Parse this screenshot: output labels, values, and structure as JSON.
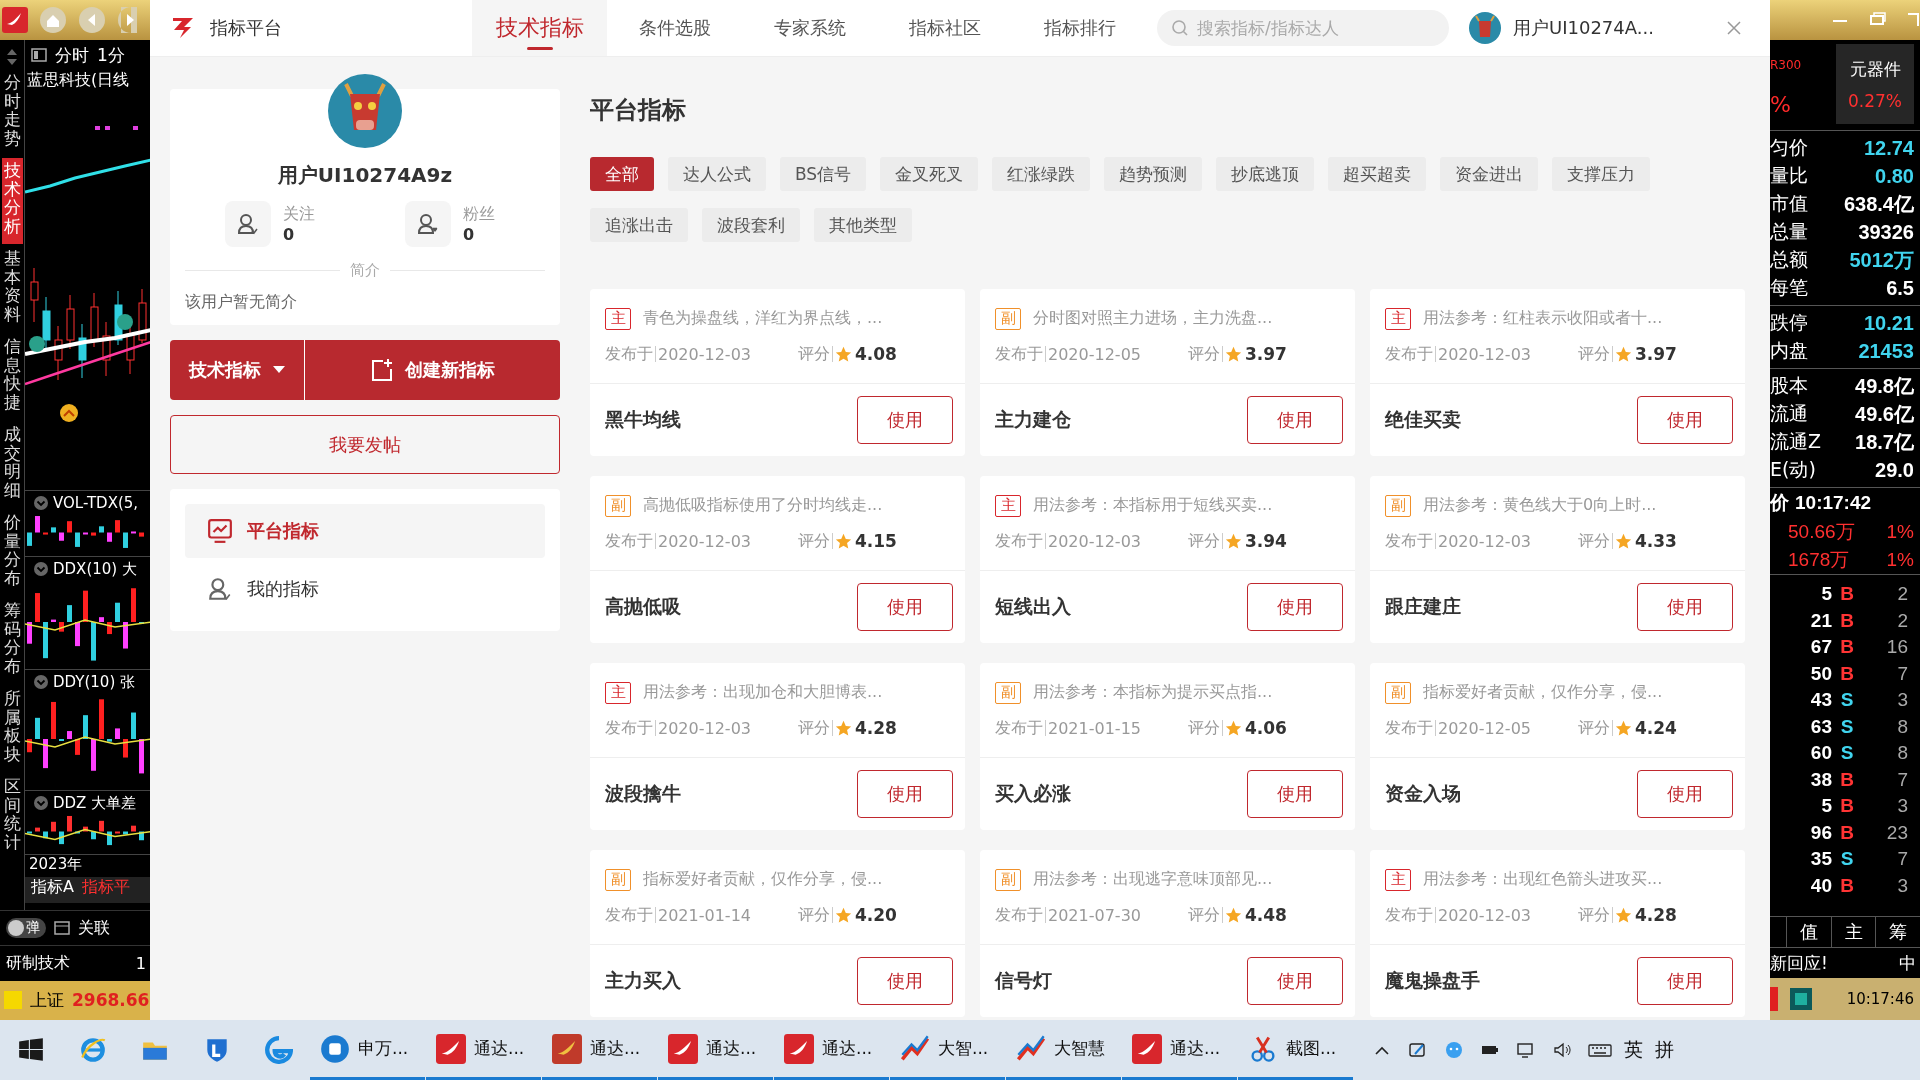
{
  "stock_app": {
    "left": {
      "vertical_tabs": [
        {
          "label": "分时走势",
          "selected": false
        },
        {
          "label": "技术分析",
          "selected": true
        },
        {
          "label": "基本资料",
          "selected": false
        },
        {
          "label": "信息快捷",
          "selected": false
        },
        {
          "label": "成交明细",
          "selected": false
        },
        {
          "label": "价量分布",
          "selected": false
        },
        {
          "label": "筹码分布",
          "selected": false
        },
        {
          "label": "所属板块",
          "selected": false
        },
        {
          "label": "区间统计",
          "selected": false
        }
      ],
      "period_tabs": [
        "分时",
        "1分"
      ],
      "stock_title": "蓝思科技(日线",
      "indicators": [
        {
          "label": "VOL-TDX(5,"
        },
        {
          "label": "DDX(10) 大"
        },
        {
          "label": "DDY(10) 张"
        },
        {
          "label": "DDZ 大单差"
        }
      ],
      "year": "2023年",
      "formula_tabs": [
        {
          "label": "指标A",
          "selected": false
        },
        {
          "label": "指标平",
          "selected": true
        }
      ],
      "popup_toggle": {
        "label": "弹",
        "on": false
      },
      "link_label": "关联",
      "status": {
        "text": "研制技术",
        "value": "1"
      },
      "market_index": {
        "name": "上证",
        "value": "2968.66"
      }
    },
    "right": {
      "index_code": "R300",
      "change_sign": "%",
      "sector": {
        "name": "元器件",
        "change": "0.27%"
      },
      "stat_groups": [
        [
          {
            "label": "匀价",
            "value": "12.74",
            "color": "#40d4ee"
          },
          {
            "label": "量比",
            "value": "0.80",
            "color": "#40d4ee"
          },
          {
            "label": "市值",
            "value": "638.4亿",
            "color": "#ffffff"
          },
          {
            "label": "总量",
            "value": "39326",
            "color": "#ffffff"
          },
          {
            "label": "总额",
            "value": "5012万",
            "color": "#40d4ee"
          },
          {
            "label": "每笔",
            "value": "6.5",
            "color": "#ffffff"
          }
        ],
        [
          {
            "label": "跌停",
            "value": "10.21",
            "color": "#40d4ee"
          },
          {
            "label": "内盘",
            "value": "21453",
            "color": "#40d4ee"
          }
        ],
        [
          {
            "label": "股本",
            "value": "49.8亿",
            "color": "#ffffff"
          },
          {
            "label": "流通",
            "value": "49.6亿",
            "color": "#ffffff"
          },
          {
            "label": "流通Z",
            "value": "18.7亿",
            "color": "#ffffff"
          },
          {
            "label": "E(动)",
            "value": "29.0",
            "color": "#ffffff"
          }
        ]
      ],
      "time": {
        "label": "价",
        "value": "10:17:42"
      },
      "flows": [
        {
          "amount": "50.66万",
          "share": "1%"
        },
        {
          "amount": "1678万",
          "share": "1%"
        }
      ],
      "trades": [
        {
          "volume": "5",
          "side": "B",
          "count": "2",
          "color": "#ff3434"
        },
        {
          "volume": "21",
          "side": "B",
          "count": "2",
          "color": "#ff3434"
        },
        {
          "volume": "67",
          "side": "B",
          "count": "16",
          "color": "#ff3434"
        },
        {
          "volume": "50",
          "side": "B",
          "count": "7",
          "color": "#ff3434"
        },
        {
          "volume": "43",
          "side": "S",
          "count": "3",
          "color": "#40d4ee"
        },
        {
          "volume": "63",
          "side": "S",
          "count": "8",
          "color": "#40d4ee"
        },
        {
          "volume": "60",
          "side": "S",
          "count": "8",
          "color": "#40d4ee"
        },
        {
          "volume": "38",
          "side": "B",
          "count": "7",
          "color": "#ff3434"
        },
        {
          "volume": "5",
          "side": "B",
          "count": "3",
          "color": "#ff3434"
        },
        {
          "volume": "96",
          "side": "B",
          "count": "23",
          "color": "#ff3434"
        },
        {
          "volume": "35",
          "side": "S",
          "count": "7",
          "color": "#40d4ee"
        },
        {
          "volume": "40",
          "side": "B",
          "count": "3",
          "color": "#ff3434"
        }
      ],
      "tabs": [
        "值",
        "主",
        "筹"
      ],
      "notice": "新回应!",
      "notice_tag": "中",
      "clock": "10:17:46"
    }
  },
  "dialog": {
    "brand": "指标平台",
    "nav_tabs": [
      {
        "label": "技术指标",
        "selected": true
      },
      {
        "label": "条件选股",
        "selected": false
      },
      {
        "label": "专家系统",
        "selected": false
      },
      {
        "label": "指标社区",
        "selected": false
      },
      {
        "label": "指标排行",
        "selected": false
      }
    ],
    "search": {
      "placeholder": "搜索指标/指标达人"
    },
    "account": {
      "name": "用户UI10274A..."
    },
    "profile": {
      "name": "用户UI10274A9z",
      "stats": [
        {
          "kind": "following",
          "label": "关注",
          "count": "0"
        },
        {
          "kind": "fans",
          "label": "粉丝",
          "count": "0"
        }
      ],
      "intro_heading": "简介",
      "intro": "该用户暂无简介"
    },
    "type_menu": {
      "label": "技术指标"
    },
    "create_button": "创建新指标",
    "post_button": "我要发帖",
    "menu": [
      {
        "kind": "chart",
        "label": "平台指标",
        "selected": true
      },
      {
        "kind": "user",
        "label": "我的指标",
        "selected": false
      }
    ],
    "section_title": "平台指标",
    "filters": [
      {
        "label": "全部",
        "selected": true
      },
      {
        "label": "达人公式",
        "selected": false
      },
      {
        "label": "BS信号",
        "selected": false
      },
      {
        "label": "金叉死叉",
        "selected": false
      },
      {
        "label": "红涨绿跌",
        "selected": false
      },
      {
        "label": "趋势预测",
        "selected": false
      },
      {
        "label": "抄底逃顶",
        "selected": false
      },
      {
        "label": "超买超卖",
        "selected": false
      },
      {
        "label": "资金进出",
        "selected": false
      },
      {
        "label": "支撑压力",
        "selected": false
      },
      {
        "label": "追涨出击",
        "selected": false
      },
      {
        "label": "波段套利",
        "selected": false
      },
      {
        "label": "其他类型",
        "selected": false
      }
    ],
    "cards": [
      {
        "kind": "main",
        "badge": "主",
        "description": "青色为操盘线，洋红为界点线，...",
        "published_label": "发布于",
        "date": "2020-12-03",
        "rating_label": "评分",
        "rating": "4.08",
        "name": "黑牛均线",
        "action": "使用"
      },
      {
        "kind": "sub",
        "badge": "副",
        "description": "分时图对照主力进场，主力洗盘...",
        "published_label": "发布于",
        "date": "2020-12-05",
        "rating_label": "评分",
        "rating": "3.97",
        "name": "主力建仓",
        "action": "使用"
      },
      {
        "kind": "main",
        "badge": "主",
        "description": "用法参考：红柱表示收阳或者十...",
        "published_label": "发布于",
        "date": "2020-12-03",
        "rating_label": "评分",
        "rating": "3.97",
        "name": "绝佳买卖",
        "action": "使用"
      },
      {
        "kind": "sub",
        "badge": "副",
        "description": "高抛低吸指标使用了分时均线走...",
        "published_label": "发布于",
        "date": "2020-12-03",
        "rating_label": "评分",
        "rating": "4.15",
        "name": "高抛低吸",
        "action": "使用"
      },
      {
        "kind": "main",
        "badge": "主",
        "description": "用法参考：本指标用于短线买卖...",
        "published_label": "发布于",
        "date": "2020-12-03",
        "rating_label": "评分",
        "rating": "3.94",
        "name": "短线出入",
        "action": "使用"
      },
      {
        "kind": "sub",
        "badge": "副",
        "description": "用法参考：黄色线大于0向上时...",
        "published_label": "发布于",
        "date": "2020-12-03",
        "rating_label": "评分",
        "rating": "4.33",
        "name": "跟庄建庄",
        "action": "使用"
      },
      {
        "kind": "main",
        "badge": "主",
        "description": "用法参考：出现加仓和大胆博表...",
        "published_label": "发布于",
        "date": "2020-12-03",
        "rating_label": "评分",
        "rating": "4.28",
        "name": "波段擒牛",
        "action": "使用"
      },
      {
        "kind": "sub",
        "badge": "副",
        "description": "用法参考：本指标为提示买点指...",
        "published_label": "发布于",
        "date": "2021-01-15",
        "rating_label": "评分",
        "rating": "4.06",
        "name": "买入必涨",
        "action": "使用"
      },
      {
        "kind": "sub",
        "badge": "副",
        "description": "指标爱好者贡献，仅作分享，侵...",
        "published_label": "发布于",
        "date": "2020-12-05",
        "rating_label": "评分",
        "rating": "4.24",
        "name": "资金入场",
        "action": "使用"
      },
      {
        "kind": "sub",
        "badge": "副",
        "description": "指标爱好者贡献，仅作分享，侵...",
        "published_label": "发布于",
        "date": "2021-01-14",
        "rating_label": "评分",
        "rating": "4.20",
        "name": "主力买入",
        "action": "使用"
      },
      {
        "kind": "sub",
        "badge": "副",
        "description": "用法参考：出现逃字意味顶部见...",
        "published_label": "发布于",
        "date": "2021-07-30",
        "rating_label": "评分",
        "rating": "4.48",
        "name": "信号灯",
        "action": "使用"
      },
      {
        "kind": "main",
        "badge": "主",
        "description": "用法参考：出现红色箭头进攻买...",
        "published_label": "发布于",
        "date": "2020-12-03",
        "rating_label": "评分",
        "rating": "4.28",
        "name": "魔鬼操盘手",
        "action": "使用"
      }
    ]
  },
  "taskbar": {
    "pinned": [
      {
        "kind": "start"
      },
      {
        "kind": "ie"
      },
      {
        "kind": "folder"
      },
      {
        "kind": "shield"
      },
      {
        "kind": "edge"
      }
    ],
    "windows": [
      {
        "kind": "sw",
        "label": "申万..."
      },
      {
        "kind": "tdx",
        "label": "通达..."
      },
      {
        "kind": "tdx-alt",
        "label": "通达..."
      },
      {
        "kind": "tdx",
        "label": "通达..."
      },
      {
        "kind": "tdx",
        "label": "通达..."
      },
      {
        "kind": "dzh",
        "label": "大智..."
      },
      {
        "kind": "dzh",
        "label": "大智慧"
      },
      {
        "kind": "tdx",
        "label": "通达..."
      },
      {
        "kind": "snip",
        "label": "截图..."
      }
    ],
    "tray": {
      "icons": [
        {
          "kind": "chevron"
        },
        {
          "kind": "pen"
        },
        {
          "kind": "face"
        },
        {
          "kind": "battery"
        },
        {
          "kind": "network"
        },
        {
          "kind": "volume"
        },
        {
          "kind": "keyboard"
        }
      ],
      "input_language": "英",
      "ime": "拼"
    }
  }
}
